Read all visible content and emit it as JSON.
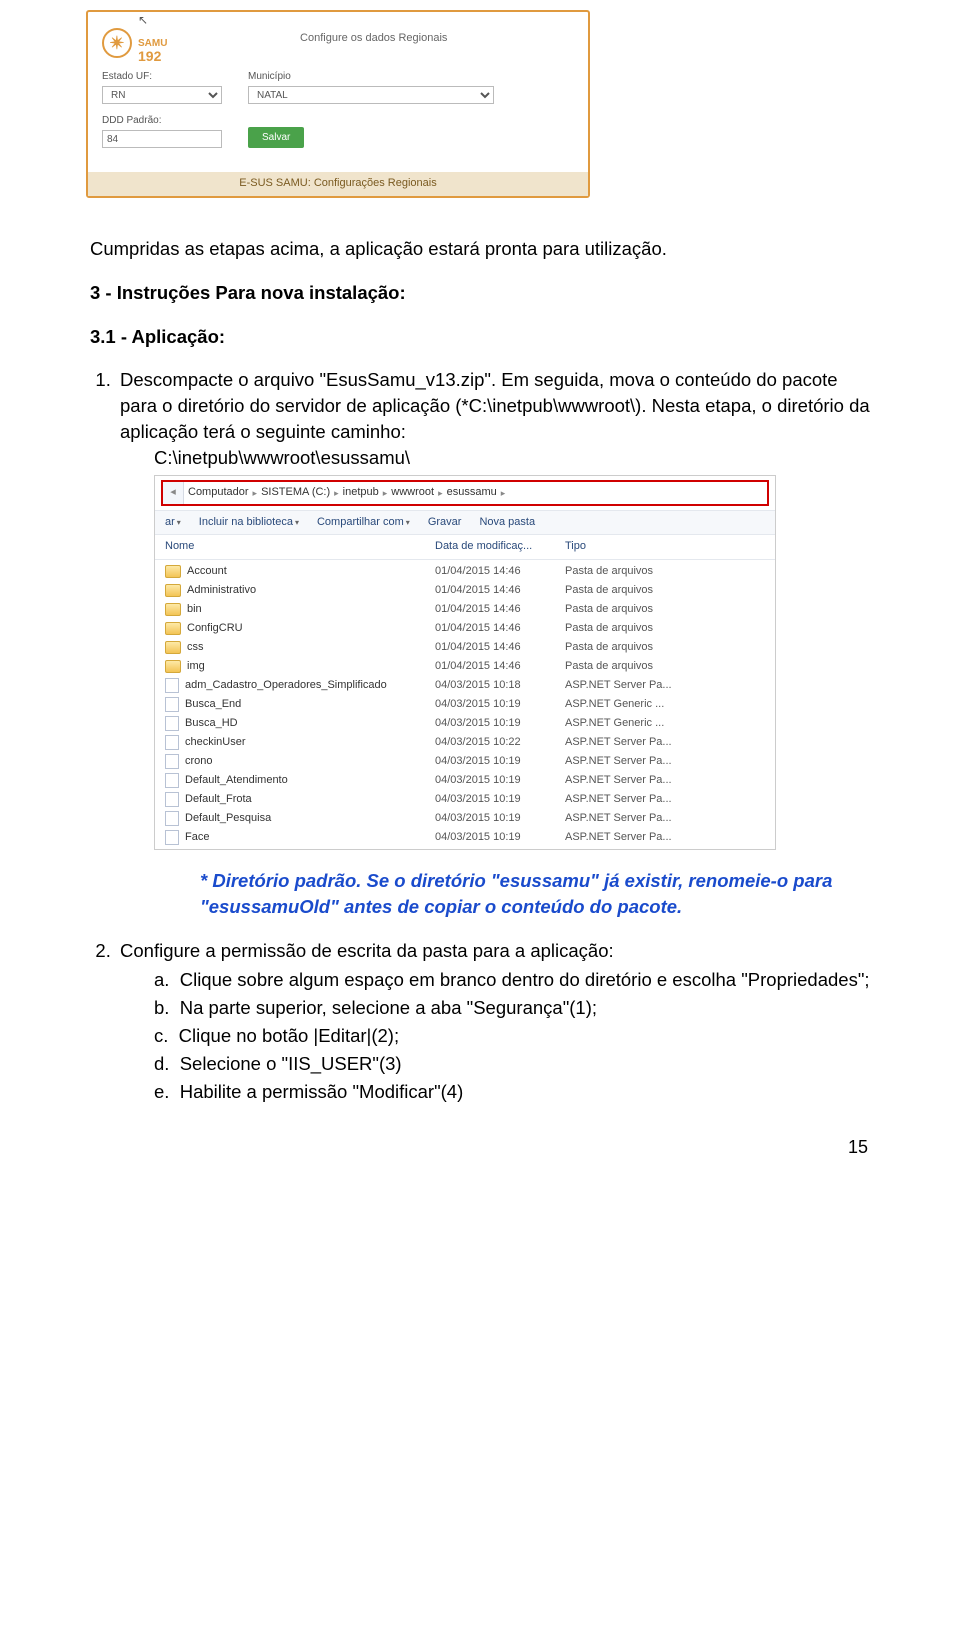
{
  "panel": {
    "cursor": "↖",
    "logo_num": "192",
    "logo_name": "SAMU",
    "title": "Configure os dados Regionais",
    "estado_label": "Estado UF:",
    "estado_value": "RN",
    "municipio_label": "Município",
    "municipio_value": "NATAL",
    "ddd_label": "DDD Padrão:",
    "ddd_value": "84",
    "save": "Salvar",
    "footer": "E-SUS SAMU: Configurações Regionais"
  },
  "text": {
    "intro": "Cumpridas as etapas acima, a aplicação estará pronta para utilização.",
    "sec3": "3 - Instruções Para nova instalação:",
    "sec31": "3.1 - Aplicação:",
    "li1a": "Descompacte o arquivo \"EsusSamu_v13.zip\". Em seguida, mova o conteúdo do pacote para o diretório do servidor de aplicação (*C:\\inetpub\\wwwroot\\). Nesta etapa, o diretório da aplicação terá o seguinte caminho:",
    "li1b": "C:\\inetpub\\wwwroot\\esussamu\\",
    "note": "* Diretório padrão. Se o diretório \"esussamu\" já existir, renomeie-o para \"esussamuOld\" antes de copiar o conteúdo do pacote.",
    "li2": "Configure a permissão de escrita da pasta para a aplicação:",
    "li2a": "Clique sobre algum espaço em branco dentro do diretório e escolha \"Propriedades\";",
    "li2b": "Na parte superior, selecione a aba \"Segurança\"(1);",
    "li2c": "Clique no botão |Editar|(2);",
    "li2d": "Selecione o \"IIS_USER\"(3)",
    "li2e": "Habilite a permissão \"Modificar\"(4)"
  },
  "explorer": {
    "crumbs": [
      "Computador",
      "SISTEMA (C:)",
      "inetpub",
      "wwwroot",
      "esussamu"
    ],
    "toolbar": {
      "ar": "ar",
      "incluir": "Incluir na biblioteca",
      "compart": "Compartilhar com",
      "gravar": "Gravar",
      "nova": "Nova pasta"
    },
    "headers": {
      "nome": "Nome",
      "data": "Data de modificaç...",
      "tipo": "Tipo"
    },
    "rows": [
      {
        "t": "folder",
        "n": "Account",
        "d": "01/04/2015 14:46",
        "k": "Pasta de arquivos"
      },
      {
        "t": "folder",
        "n": "Administrativo",
        "d": "01/04/2015 14:46",
        "k": "Pasta de arquivos"
      },
      {
        "t": "folder",
        "n": "bin",
        "d": "01/04/2015 14:46",
        "k": "Pasta de arquivos"
      },
      {
        "t": "folder",
        "n": "ConfigCRU",
        "d": "01/04/2015 14:46",
        "k": "Pasta de arquivos"
      },
      {
        "t": "folder",
        "n": "css",
        "d": "01/04/2015 14:46",
        "k": "Pasta de arquivos"
      },
      {
        "t": "folder",
        "n": "img",
        "d": "01/04/2015 14:46",
        "k": "Pasta de arquivos"
      },
      {
        "t": "aspx",
        "n": "adm_Cadastro_Operadores_Simplificado",
        "d": "04/03/2015 10:18",
        "k": "ASP.NET Server Pa..."
      },
      {
        "t": "aspx",
        "n": "Busca_End",
        "d": "04/03/2015 10:19",
        "k": "ASP.NET Generic ..."
      },
      {
        "t": "aspx",
        "n": "Busca_HD",
        "d": "04/03/2015 10:19",
        "k": "ASP.NET Generic ..."
      },
      {
        "t": "aspx",
        "n": "checkinUser",
        "d": "04/03/2015 10:22",
        "k": "ASP.NET Server Pa..."
      },
      {
        "t": "aspx",
        "n": "crono",
        "d": "04/03/2015 10:19",
        "k": "ASP.NET Server Pa..."
      },
      {
        "t": "aspx",
        "n": "Default_Atendimento",
        "d": "04/03/2015 10:19",
        "k": "ASP.NET Server Pa..."
      },
      {
        "t": "aspx",
        "n": "Default_Frota",
        "d": "04/03/2015 10:19",
        "k": "ASP.NET Server Pa..."
      },
      {
        "t": "aspx",
        "n": "Default_Pesquisa",
        "d": "04/03/2015 10:19",
        "k": "ASP.NET Server Pa..."
      },
      {
        "t": "aspx",
        "n": "Face",
        "d": "04/03/2015 10:19",
        "k": "ASP.NET Server Pa..."
      }
    ]
  },
  "pagenum": "15"
}
